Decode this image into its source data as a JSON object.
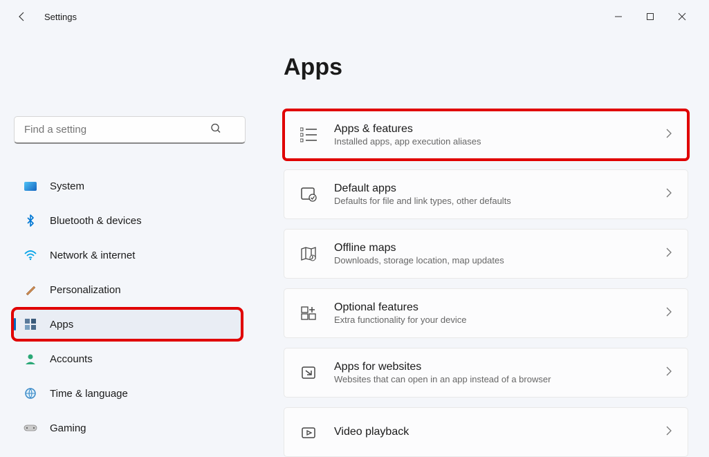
{
  "window": {
    "title": "Settings"
  },
  "search": {
    "placeholder": "Find a setting"
  },
  "sidebar": {
    "items": [
      {
        "label": "System",
        "icon": "display-icon"
      },
      {
        "label": "Bluetooth & devices",
        "icon": "bluetooth-icon"
      },
      {
        "label": "Network & internet",
        "icon": "wifi-icon"
      },
      {
        "label": "Personalization",
        "icon": "brush-icon"
      },
      {
        "label": "Apps",
        "icon": "apps-icon",
        "active": true,
        "highlighted": true
      },
      {
        "label": "Accounts",
        "icon": "person-icon"
      },
      {
        "label": "Time & language",
        "icon": "globe-clock-icon"
      },
      {
        "label": "Gaming",
        "icon": "gamepad-icon"
      }
    ]
  },
  "page": {
    "title": "Apps",
    "cards": [
      {
        "title": "Apps & features",
        "sub": "Installed apps, app execution aliases",
        "icon": "list-icon",
        "highlighted": true
      },
      {
        "title": "Default apps",
        "sub": "Defaults for file and link types, other defaults",
        "icon": "default-app-icon"
      },
      {
        "title": "Offline maps",
        "sub": "Downloads, storage location, map updates",
        "icon": "map-icon"
      },
      {
        "title": "Optional features",
        "sub": "Extra functionality for your device",
        "icon": "add-feature-icon"
      },
      {
        "title": "Apps for websites",
        "sub": "Websites that can open in an app instead of a browser",
        "icon": "website-app-icon"
      },
      {
        "title": "Video playback",
        "sub": "",
        "icon": "video-icon"
      }
    ]
  }
}
